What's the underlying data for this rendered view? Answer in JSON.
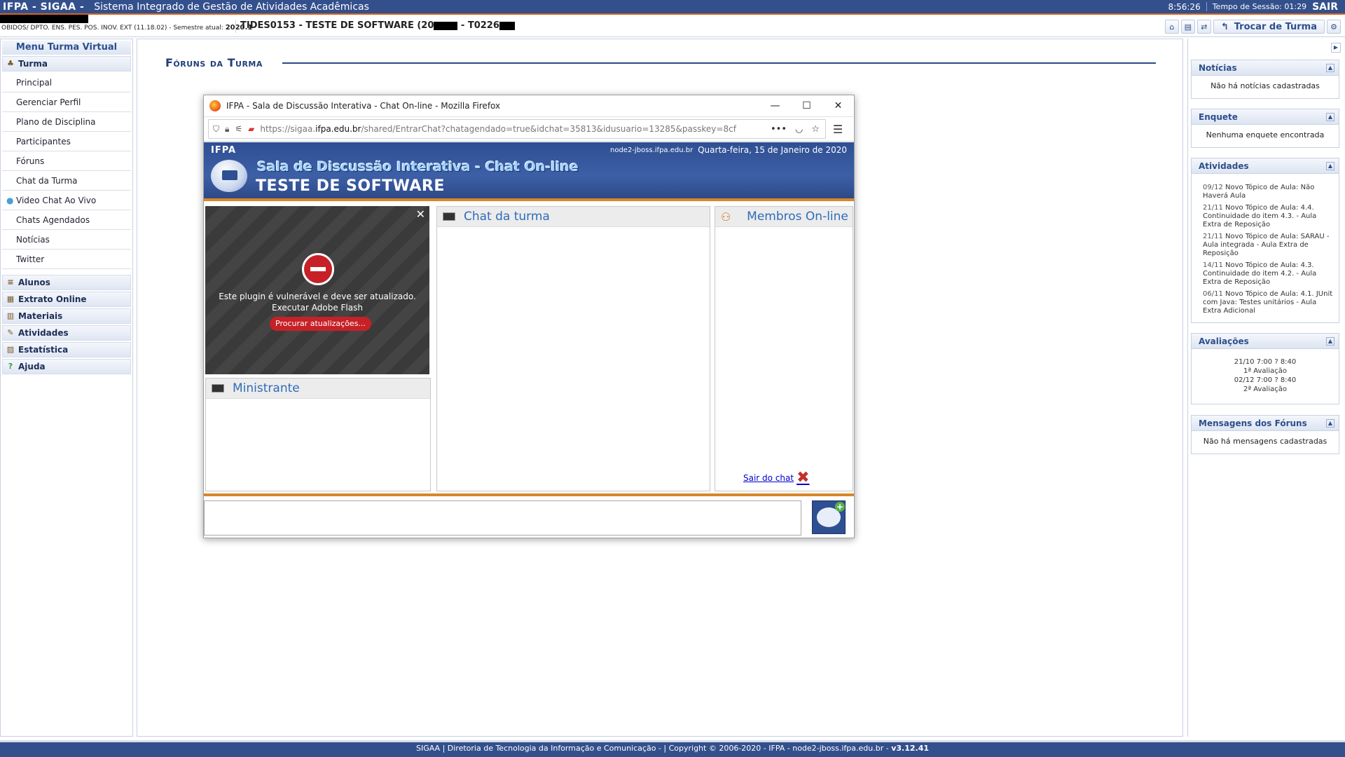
{
  "topbar": {
    "brand": "IFPA - SIGAA -",
    "system_name": "Sistema Integrado de Gestão de Atividades Acadêmicas",
    "clock": "8:56:26",
    "session_time": "Tempo de Sessão: 01:29",
    "logout_label": "SAIR"
  },
  "infobar": {
    "department": "OBIDOS/ DPTO. ENS. PES. POS. INOV. EXT (11.18.02) - Semestre atual:",
    "semester": "2020.1",
    "turma_prefix": "TIDES0153 - TESTE DE SOFTWARE (20",
    "turma_mid": " - T0226",
    "trocar_label": "Trocar de Turma"
  },
  "left_menu": {
    "title": "Menu Turma Virtual",
    "turma_header": "Turma",
    "items": [
      {
        "label": "Principal"
      },
      {
        "label": "Gerenciar Perfil"
      },
      {
        "label": "Plano de Disciplina"
      },
      {
        "label": "Participantes"
      },
      {
        "label": "Fóruns"
      },
      {
        "label": "Chat da Turma"
      },
      {
        "label": "Video Chat Ao Vivo"
      },
      {
        "label": "Chats Agendados"
      },
      {
        "label": "Notícias"
      },
      {
        "label": "Twitter"
      }
    ],
    "sections": [
      {
        "label": "Alunos"
      },
      {
        "label": "Extrato Online"
      },
      {
        "label": "Materiais"
      },
      {
        "label": "Atividades"
      },
      {
        "label": "Estatística"
      },
      {
        "label": "Ajuda"
      }
    ]
  },
  "main": {
    "page_title": "Fóruns da Turma"
  },
  "right_panels": {
    "noticias": {
      "title": "Notícias",
      "body": "Não há notícias cadastradas"
    },
    "enquete": {
      "title": "Enquete",
      "body": "Nenhuma enquete encontrada"
    },
    "atividades": {
      "title": "Atividades",
      "items": [
        {
          "date": "09/12",
          "text": "Novo Tópico de Aula: Não Haverá Aula"
        },
        {
          "date": "21/11",
          "text": "Novo Tópico de Aula: 4.4. Continuidade do item 4.3. - Aula Extra de Reposição"
        },
        {
          "date": "21/11",
          "text": "Novo Tópico de Aula: SARAU - Aula integrada - Aula Extra de Reposição"
        },
        {
          "date": "14/11",
          "text": "Novo Tópico de Aula: 4.3. Continuidade do item 4.2. - Aula Extra de Reposição"
        },
        {
          "date": "06/11",
          "text": "Novo Tópico de Aula: 4.1. JUnit com Java: Testes unitários - Aula Extra Adicional"
        }
      ]
    },
    "avaliacoes": {
      "title": "Avaliações",
      "items": [
        {
          "when": "21/10 7:00 ? 8:40",
          "name": "1ª Avaliação"
        },
        {
          "when": "02/12 7:00 ? 8:40",
          "name": "2ª Avaliação"
        }
      ]
    },
    "mensagens": {
      "title": "Mensagens dos Fóruns",
      "body": "Não há mensagens cadastradas"
    }
  },
  "footer": {
    "text": "SIGAA | Diretoria de Tecnologia da Informação e Comunicação - | Copyright © 2006-2020 - IFPA - node2-jboss.ifpa.edu.br -",
    "version": "v3.12.41"
  },
  "popup": {
    "window_title": "IFPA - Sala de Discussão Interativa - Chat On-line - Mozilla Firefox",
    "url_prefix": "https://sigaa.",
    "url_domain": "ifpa.edu.br",
    "url_rest": "/shared/EntrarChat?chatagendado=true&idchat=35813&idusuario=13285&passkey=8cf",
    "header": {
      "org": "IFPA",
      "node": "node2-jboss.ifpa.edu.br",
      "date": "Quarta-feira, 15 de Janeiro de 2020",
      "title": "Sala de Discussão Interativa - Chat On-line",
      "subtitle": "TESTE DE SOFTWARE"
    },
    "flash": {
      "message_line1": "Este plugin é vulnerável e deve ser atualizado.",
      "message_line2": "Executar Adobe Flash",
      "update_button": "Procurar atualizações..."
    },
    "panels": {
      "ministrante": "Ministrante",
      "chat": "Chat da turma",
      "membros": "Membros On-line"
    },
    "leave_chat": "Sair do chat"
  }
}
